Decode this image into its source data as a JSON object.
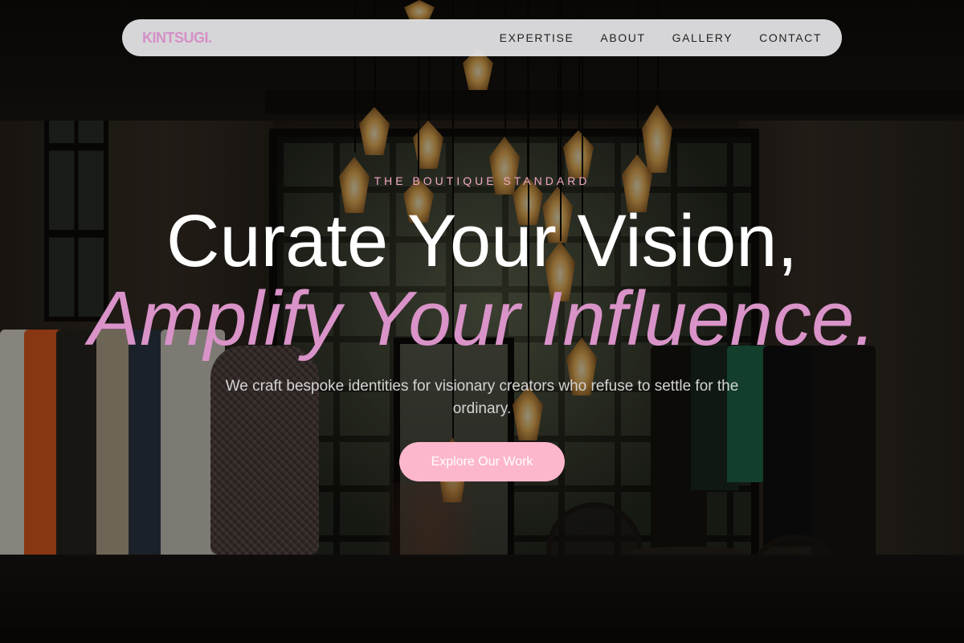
{
  "nav": {
    "brand": "KINTSUGI.",
    "links": [
      "EXPERTISE",
      "ABOUT",
      "GALLERY",
      "CONTACT"
    ]
  },
  "hero": {
    "eyebrow": "THE BOUTIQUE STANDARD",
    "headline_line1": "Curate Your Vision,",
    "headline_line2": "Amplify Your Influence.",
    "subheading": "We craft bespoke identities for visionary creators who refuse to settle for the ordinary.",
    "cta_label": "Explore Our Work"
  },
  "colors": {
    "accent_pink": "#fdb7cc",
    "brand_pink": "#d58fc6",
    "headline_pink": "#d993c8",
    "nav_background": "#e8e8ea"
  },
  "background": {
    "description_icon": "boutique-interior-image"
  }
}
